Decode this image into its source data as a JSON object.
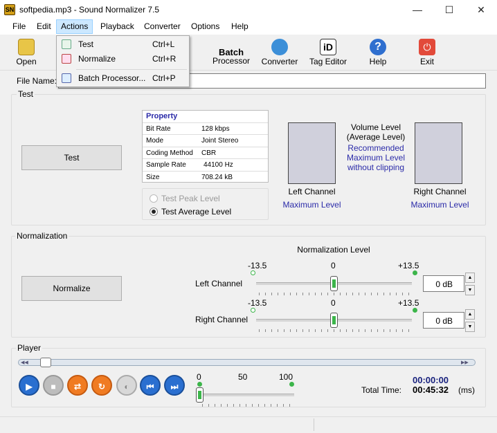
{
  "window": {
    "title": "softpedia.mp3 - Sound Normalizer 7.5",
    "app_icon_text": "SN",
    "minimize": "—",
    "maximize": "☐",
    "close": "✕"
  },
  "menu": [
    "File",
    "Edit",
    "Actions",
    "Playback",
    "Converter",
    "Options",
    "Help"
  ],
  "toolbar": {
    "open": "Open",
    "batch1": "Batch",
    "batch2": "Processor",
    "converter": "Converter",
    "tag_editor": "Tag Editor",
    "help": "Help",
    "exit": "Exit"
  },
  "dropdown": [
    {
      "label": "Test",
      "shortcut": "Ctrl+L"
    },
    {
      "label": "Normalize",
      "shortcut": "Ctrl+R"
    },
    {
      "label": "Batch Processor...",
      "shortcut": "Ctrl+P"
    }
  ],
  "file": {
    "label": "File Name:",
    "value": ""
  },
  "test": {
    "group_label": "Test",
    "button": "Test",
    "property_header": "Property",
    "properties": [
      {
        "key": "Bit Rate",
        "value": "128 kbps"
      },
      {
        "key": "Mode",
        "value": "Joint Stereo"
      },
      {
        "key": "Coding Method",
        "value": "CBR"
      },
      {
        "key": "Sample Rate",
        "value": "44100 Hz"
      },
      {
        "key": "Size",
        "value": "708.24 kB"
      }
    ],
    "radio_peak": "Test Peak Level",
    "radio_average": "Test Average Level",
    "volume_title1": "Volume Level",
    "volume_title2": "(Average Level)",
    "rec1": "Recommended",
    "rec2": "Maximum Level",
    "rec3": "without clipping",
    "left_channel": "Left Channel",
    "right_channel": "Right Channel",
    "max_level_left": "Maximum Level",
    "max_level_right": "Maximum Level"
  },
  "normalization": {
    "group_label": "Normalization",
    "button": "Normalize",
    "level_title": "Normalization Level",
    "min": "-13.5",
    "mid": "0",
    "max": "+13.5",
    "left_label": "Left Channel",
    "right_label": "Right Channel",
    "left_value": "0 dB",
    "right_value": "0 dB"
  },
  "player": {
    "group_label": "Player",
    "vol_min": "0",
    "vol_mid": "50",
    "vol_max": "100",
    "current_time": "00:00:00",
    "total_label": "Total Time:",
    "total_time": "00:45:32",
    "unit": "(ms)"
  }
}
